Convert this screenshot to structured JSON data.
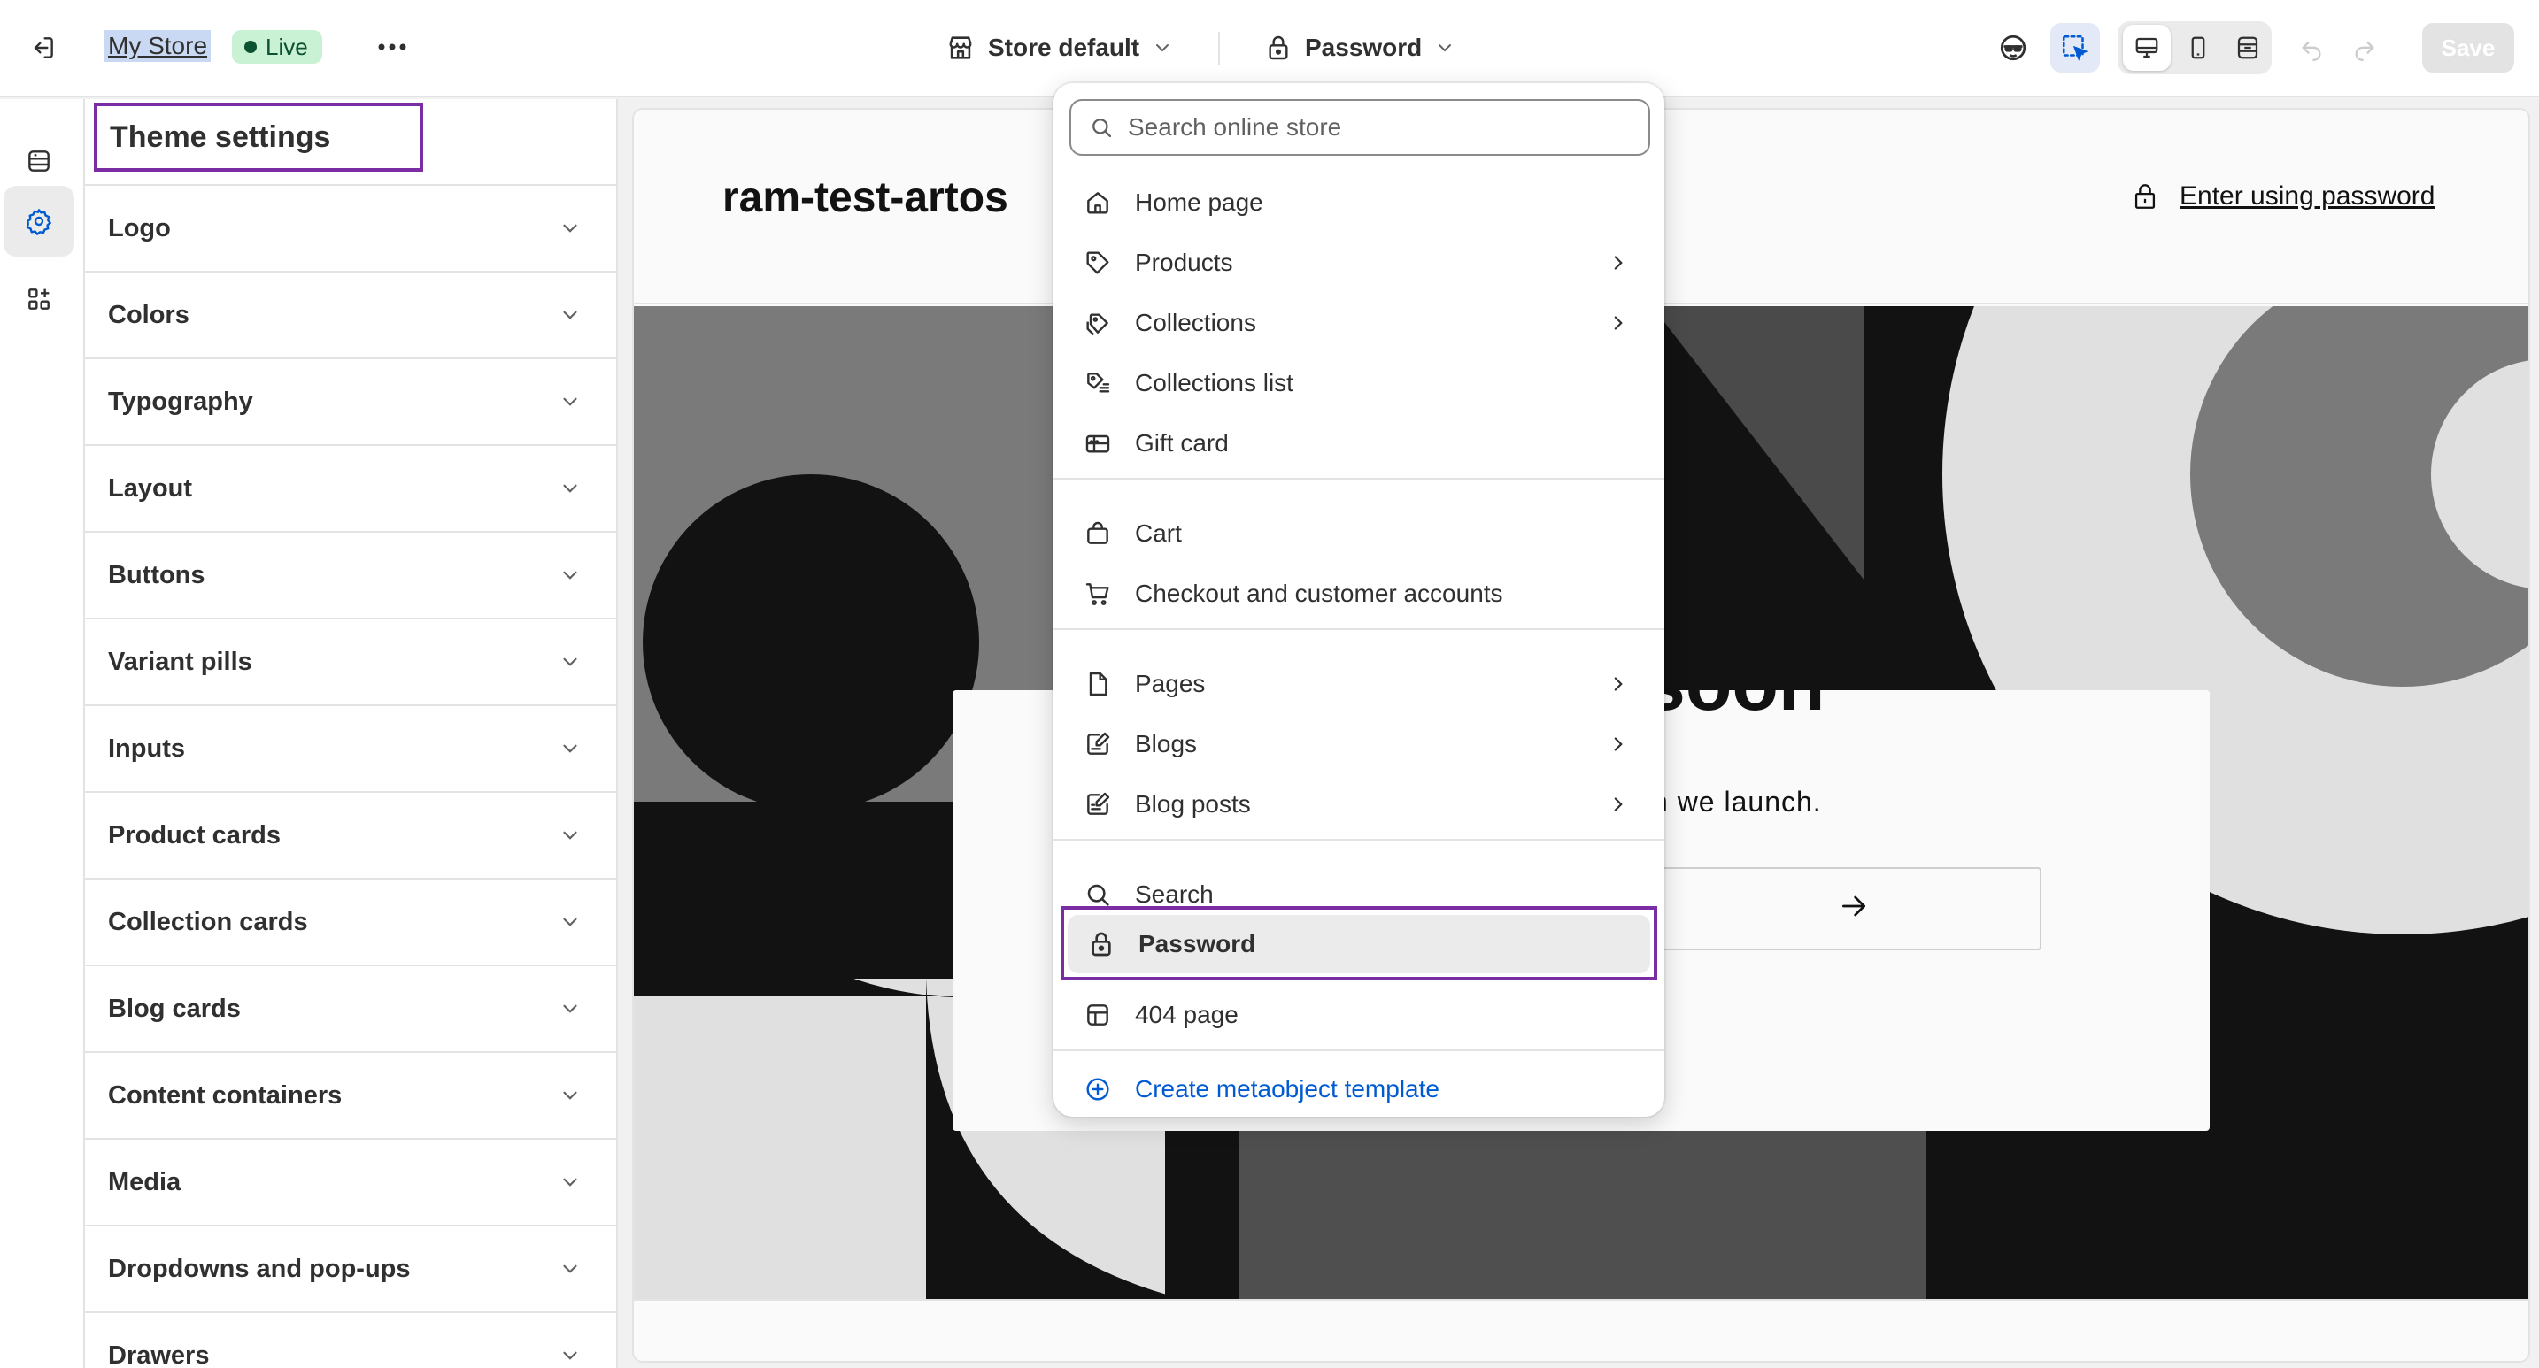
{
  "topbar": {
    "store_name": "My Store",
    "live_label": "Live",
    "template_label": "Store default",
    "page_label": "Password",
    "save_label": "Save"
  },
  "panel": {
    "title": "Theme settings",
    "items": [
      {
        "label": "Logo"
      },
      {
        "label": "Colors"
      },
      {
        "label": "Typography"
      },
      {
        "label": "Layout"
      },
      {
        "label": "Buttons"
      },
      {
        "label": "Variant pills"
      },
      {
        "label": "Inputs"
      },
      {
        "label": "Product cards"
      },
      {
        "label": "Collection cards"
      },
      {
        "label": "Blog cards"
      },
      {
        "label": "Content containers"
      },
      {
        "label": "Media"
      },
      {
        "label": "Dropdowns and pop-ups"
      },
      {
        "label": "Drawers"
      }
    ]
  },
  "preview": {
    "store_title": "ram-test-artos",
    "enter_link": "Enter using password",
    "heading_partial": "soon",
    "subtext_partial": "n we launch."
  },
  "dropdown": {
    "search_placeholder": "Search online store",
    "items": [
      {
        "label": "Home page",
        "icon": "home-icon"
      },
      {
        "label": "Products",
        "icon": "tag-icon"
      },
      {
        "label": "Collections",
        "icon": "collection-icon"
      },
      {
        "label": "Collections list",
        "icon": "collection-list-icon"
      },
      {
        "label": "Gift card",
        "icon": "gift-card-icon"
      },
      {
        "label": "Cart",
        "icon": "bag-icon"
      },
      {
        "label": "Checkout and customer accounts",
        "icon": "cart-icon"
      },
      {
        "label": "Pages",
        "icon": "page-icon"
      },
      {
        "label": "Blogs",
        "icon": "blog-icon"
      },
      {
        "label": "Blog posts",
        "icon": "blog-post-icon"
      },
      {
        "label": "Search",
        "icon": "search-icon"
      },
      {
        "label": "Password",
        "icon": "lock-icon"
      },
      {
        "label": "404 page",
        "icon": "layout-icon"
      },
      {
        "label": "Create metaobject template",
        "icon": "plus-circle-icon"
      }
    ]
  },
  "colors": {
    "accent_purple": "#7b2ea3",
    "live_green": "#c9f2d5",
    "link_blue": "#005bd3",
    "selection_blue": "#c9d8f3"
  }
}
